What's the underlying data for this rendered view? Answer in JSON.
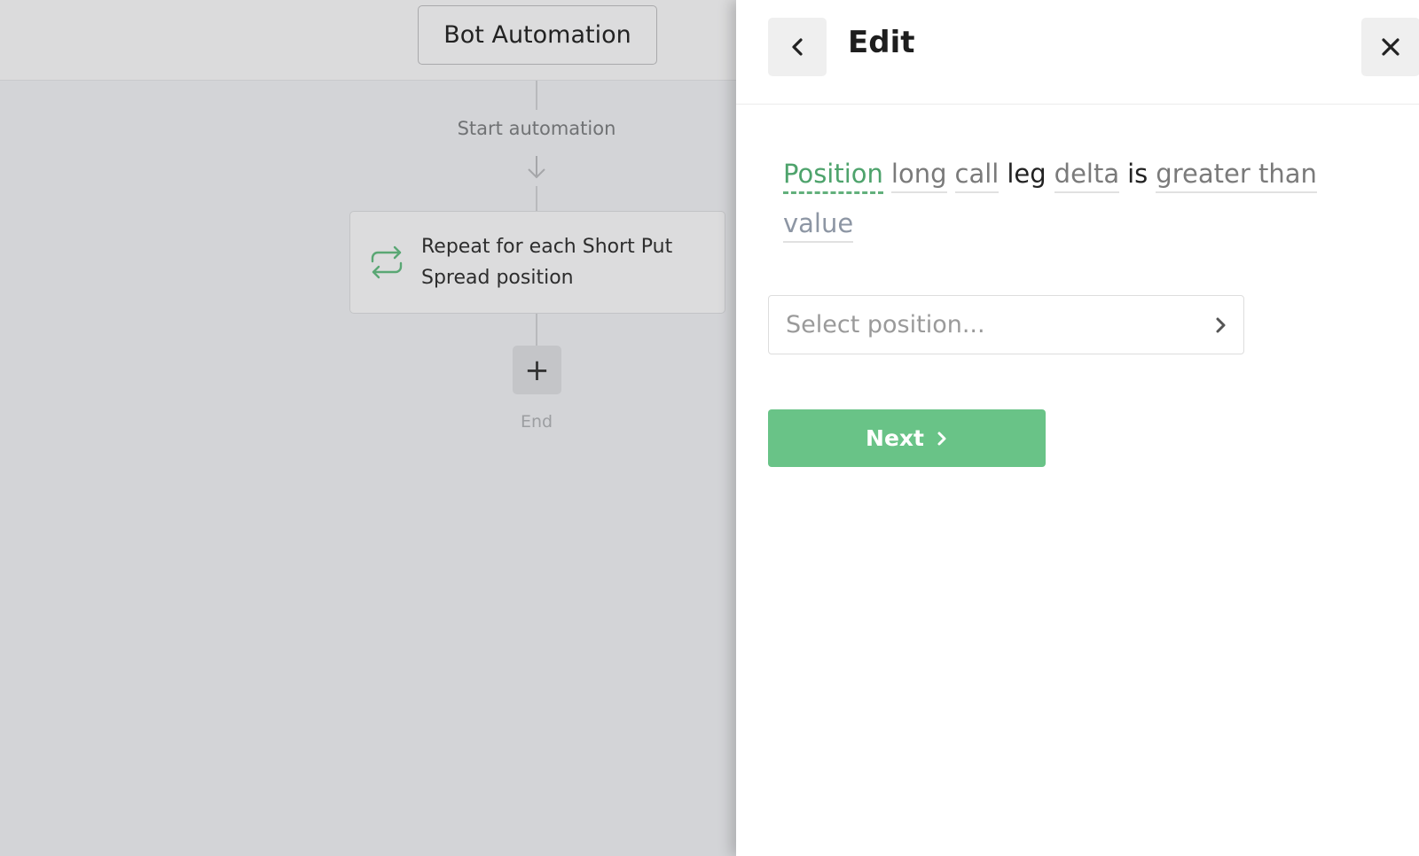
{
  "canvas": {
    "title": "Bot Automation",
    "start_label": "Start automation",
    "repeat_step": "Repeat for each Short Put Spread position",
    "add_symbol": "+",
    "end_label": "End"
  },
  "panel": {
    "title": "Edit",
    "sentence": {
      "t1": "Position",
      "t2": "long",
      "t3": "call",
      "t4": "leg",
      "t5": "delta",
      "t6": "is",
      "t7": "greater than",
      "t8": "value"
    },
    "select": {
      "placeholder": "Select position..."
    },
    "next_label": "Next"
  },
  "icons": {
    "back": "chevron-left-icon",
    "close": "close-icon",
    "repeat": "repeat-icon",
    "select": "chevron-right-icon",
    "next": "chevron-right-icon",
    "flow_arrow": "arrow-down-icon"
  },
  "colors": {
    "accent_green": "#69c387",
    "active_token": "#4ea36c",
    "value_token": "#8d96a4",
    "overlay_bg": "#d3d4d7"
  }
}
